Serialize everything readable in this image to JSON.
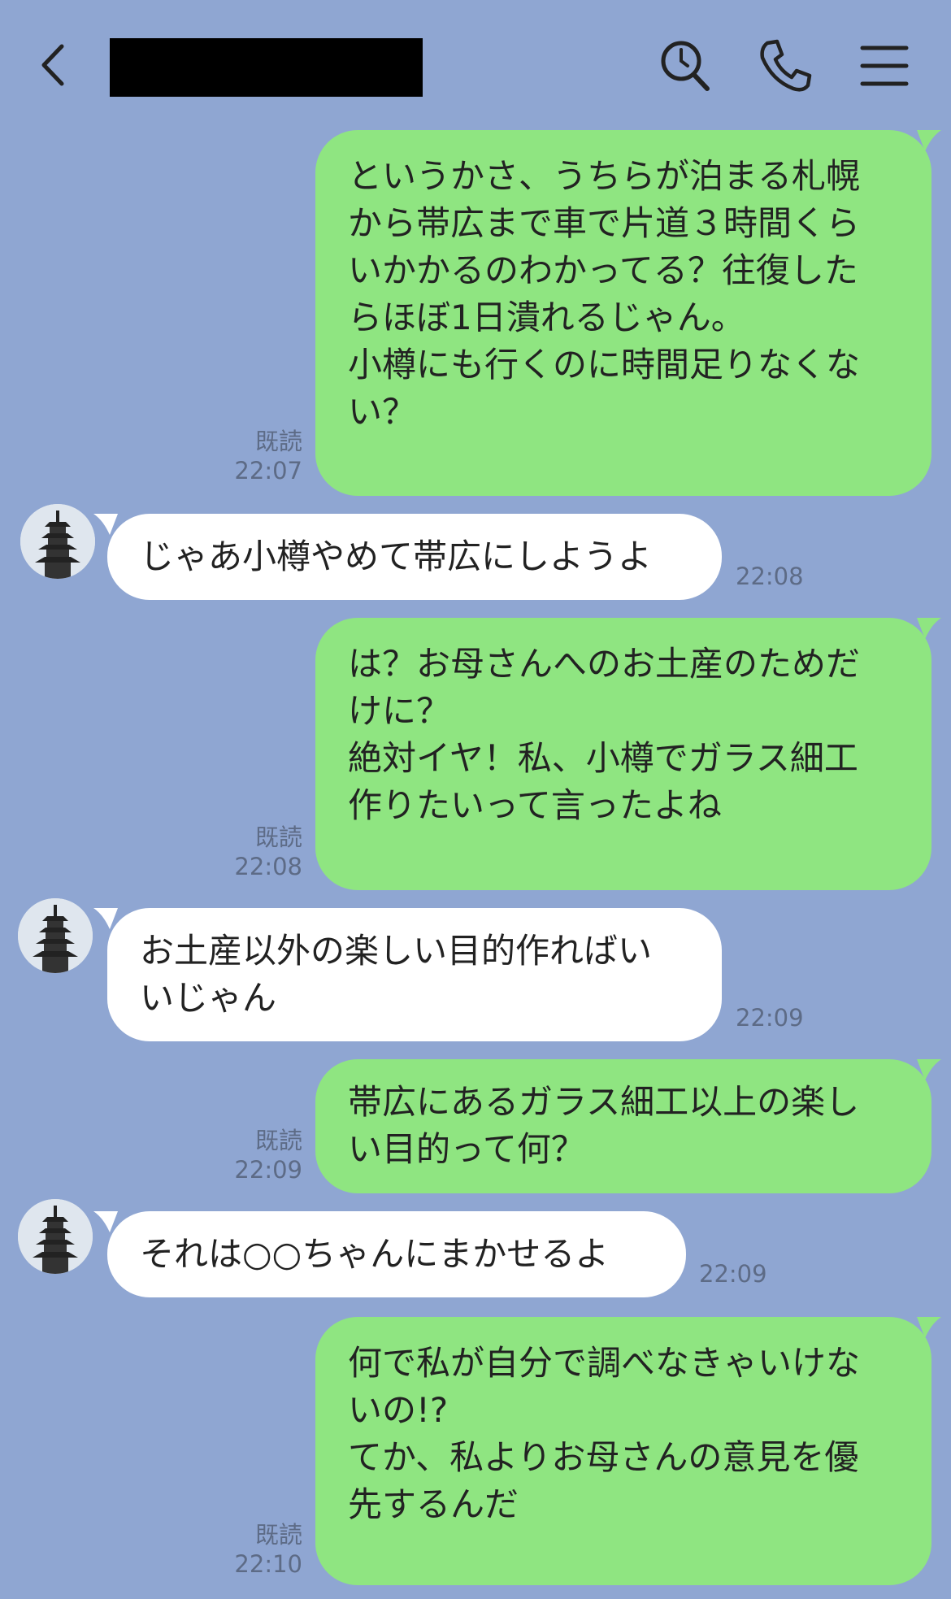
{
  "header": {
    "back_icon": "chevron-left-icon",
    "search_icon": "search-icon",
    "call_icon": "phone-icon",
    "menu_icon": "menu-icon"
  },
  "messages": [
    {
      "side": "out",
      "lines": [
        "というかさ、うちらが泊まる札幌",
        "から帯広まで車で片道３時間くら",
        "いかかるのわかってる？往復した",
        "らほぼ1日潰れるじゃん。",
        "小樽にも行くのに時間足りなくな",
        "い？"
      ],
      "read": "既読",
      "time": "22:07"
    },
    {
      "side": "in",
      "lines": [
        "じゃあ小樽やめて帯広にしようよ"
      ],
      "time": "22:08"
    },
    {
      "side": "out",
      "lines": [
        "は？お母さんへのお土産のためだ",
        "けに？",
        "絶対イヤ！私、小樽でガラス細工",
        "作りたいって言ったよね"
      ],
      "read": "既読",
      "time": "22:08"
    },
    {
      "side": "in",
      "lines": [
        "お土産以外の楽しい目的作ればい",
        "いじゃん"
      ],
      "time": "22:09"
    },
    {
      "side": "out",
      "lines": [
        "帯広にあるガラス細工以上の楽し",
        "い目的って何？"
      ],
      "read": "既読",
      "time": "22:09"
    },
    {
      "side": "in",
      "lines": [
        "それは○○ちゃんにまかせるよ"
      ],
      "time": "22:09"
    },
    {
      "side": "out",
      "lines": [
        "何で私が自分で調べなきゃいけな",
        "いの!?",
        "てか、私よりお母さんの意見を優",
        "先するんだ"
      ],
      "read": "既読",
      "time": "22:10"
    }
  ]
}
